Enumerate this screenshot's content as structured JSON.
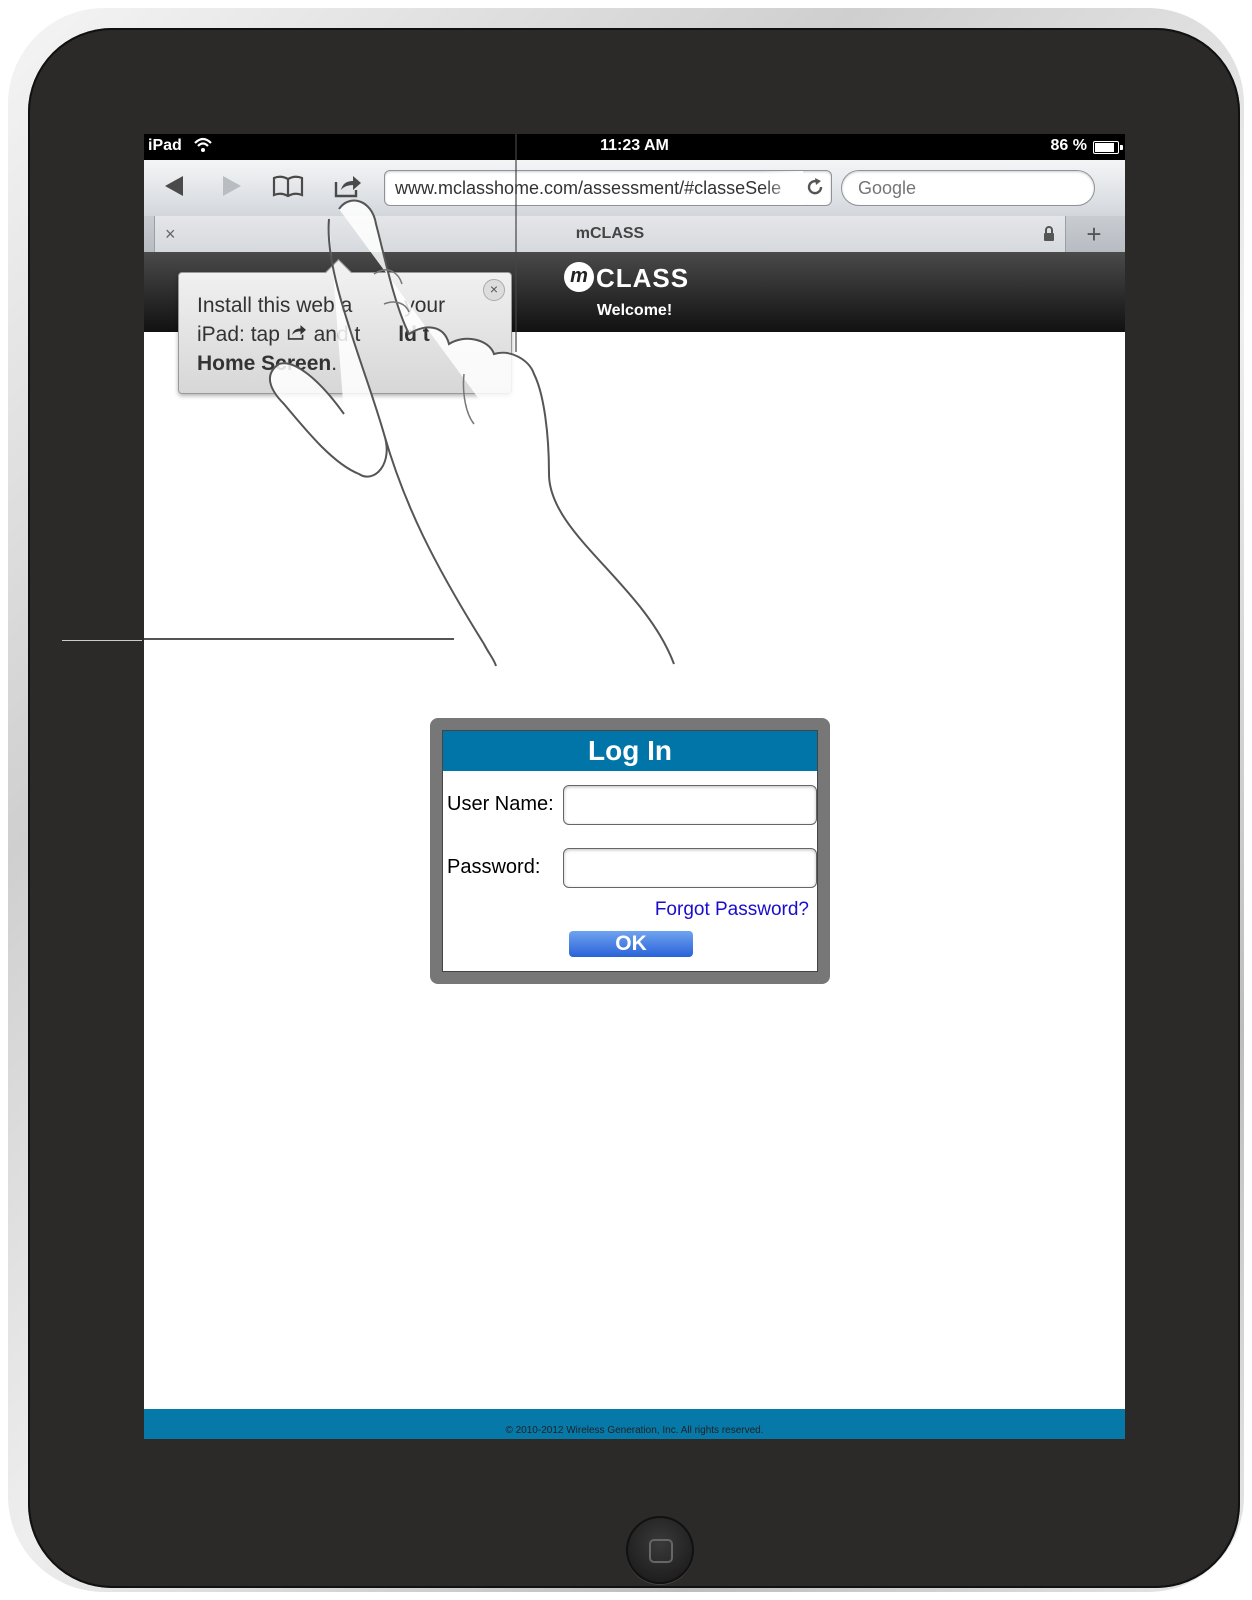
{
  "statusbar": {
    "device": "iPad",
    "time": "11:23 AM",
    "battery": "86 %",
    "battery_level": 0.86
  },
  "browser": {
    "url": "www.mclasshome.com/assessment/#classeSele",
    "search_placeholder": "Google",
    "tab_title": "mCLASS",
    "tab_close": "×",
    "new_tab": "+"
  },
  "app": {
    "logo_letter": "m",
    "logo_text": "CLASS",
    "welcome": "Welcome!"
  },
  "tooltip": {
    "line1_a": "Install this web a",
    "line1_b": "your",
    "line2_a": "iPad: tap ",
    "line2_b": " and t",
    "line2_c": "ld t",
    "line3_bold": "Home Screen",
    "line3_end": ".",
    "close": "×"
  },
  "login": {
    "title": "Log In",
    "user_label": "User Name:",
    "password_label": "Password:",
    "forgot": "Forgot Password?",
    "ok": "OK"
  },
  "footer": {
    "copyright": "© 2010-2012 Wireless Generation, Inc. All rights reserved."
  },
  "colors": {
    "brand_blue": "#0275a8",
    "link": "#1a0dcc"
  }
}
